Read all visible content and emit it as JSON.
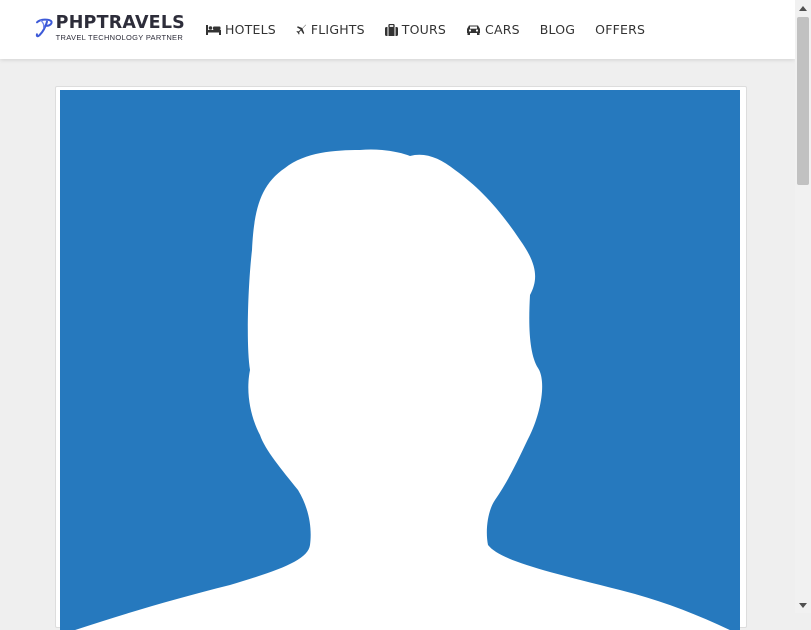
{
  "brand": {
    "name": "PHPTRAVELS",
    "tagline": "TRAVEL TECHNOLOGY PARTNER",
    "logo_icon": "phptravels-logo-icon",
    "accent": "#3d5ad8"
  },
  "nav": {
    "items": [
      {
        "label": "HOTELS",
        "icon": "bed-icon"
      },
      {
        "label": "FLIGHTS",
        "icon": "airplane-icon"
      },
      {
        "label": "TOURS",
        "icon": "suitcase-icon"
      },
      {
        "label": "CARS",
        "icon": "car-icon"
      },
      {
        "label": "BLOG",
        "icon": ""
      },
      {
        "label": "OFFERS",
        "icon": ""
      }
    ]
  },
  "profile": {
    "avatar_icon": "default-user-silhouette",
    "avatar_background": "#2679be"
  },
  "colors": {
    "page_background": "#efefef",
    "nav_text": "#333333"
  }
}
